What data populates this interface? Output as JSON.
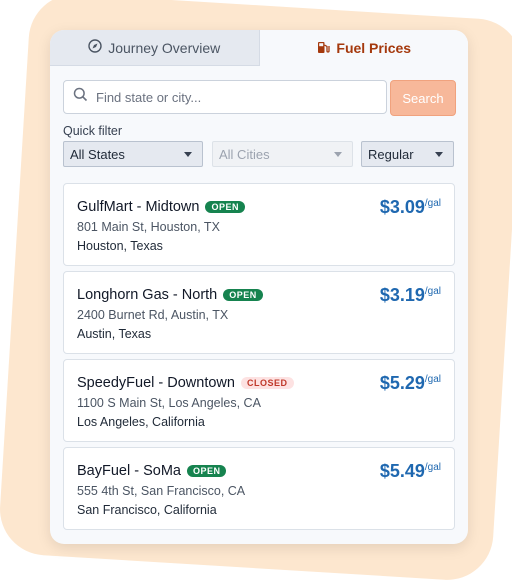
{
  "tabs": [
    {
      "label": "Journey Overview",
      "icon": "compass-icon",
      "active": false
    },
    {
      "label": "Fuel Prices",
      "icon": "fuel-pump-icon",
      "active": true
    }
  ],
  "search": {
    "placeholder": "Find state or city...",
    "value": "",
    "button_label": "Search"
  },
  "quick_filter": {
    "label": "Quick filter",
    "state": "All States",
    "city": "All Cities",
    "fuel_type": "Regular"
  },
  "stations": [
    {
      "name": "GulfMart - Midtown",
      "status": "OPEN",
      "address": "801 Main St, Houston, TX",
      "city": "Houston, Texas",
      "price": "$3.09",
      "unit": "/gal"
    },
    {
      "name": "Longhorn Gas - North",
      "status": "OPEN",
      "address": "2400 Burnet Rd, Austin, TX",
      "city": "Austin, Texas",
      "price": "$3.19",
      "unit": "/gal"
    },
    {
      "name": "SpeedyFuel - Downtown",
      "status": "CLOSED",
      "address": "1100 S Main St, Los Angeles, CA",
      "city": "Los Angeles, California",
      "price": "$5.29",
      "unit": "/gal"
    },
    {
      "name": "BayFuel - SoMa",
      "status": "OPEN",
      "address": "555 4th St, San Francisco, CA",
      "city": "San Francisco, California",
      "price": "$5.49",
      "unit": "/gal"
    }
  ],
  "colors": {
    "accent": "#a5390d",
    "price": "#1f68b0",
    "open": "#16834f",
    "closed": "#c0392b"
  }
}
